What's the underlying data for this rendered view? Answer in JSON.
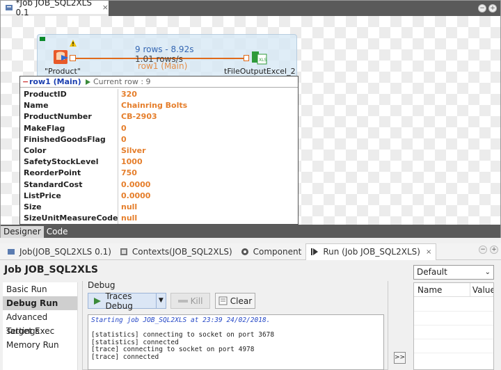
{
  "editor": {
    "tab_title": "*Job JOB_SQL2XLS 0.1",
    "tab_close": "×",
    "bottom_tabs": [
      {
        "label": "Designer",
        "active": true
      },
      {
        "label": "Code",
        "active": false
      }
    ]
  },
  "canvas": {
    "stat_rows": "9 rows - 8.92s",
    "stat_rate": "1.01 rows/s",
    "flow_label": "row1 (Main)",
    "source_component": "\"Product\"",
    "target_component": "tFileOutputExcel_2"
  },
  "trace": {
    "row_name": "row1 (Main)",
    "current_row": "Current row : 9",
    "fields": [
      {
        "key": "ProductID",
        "value": "320"
      },
      {
        "key": "Name",
        "value": "Chainring Bolts"
      },
      {
        "key": "ProductNumber",
        "value": "CB-2903"
      },
      {
        "key": "MakeFlag",
        "value": "0"
      },
      {
        "key": "FinishedGoodsFlag",
        "value": "0"
      },
      {
        "key": "Color",
        "value": "Silver"
      },
      {
        "key": "SafetyStockLevel",
        "value": "1000"
      },
      {
        "key": "ReorderPoint",
        "value": "750"
      },
      {
        "key": "StandardCost",
        "value": "0.0000"
      },
      {
        "key": "ListPrice",
        "value": "0.0000"
      },
      {
        "key": "Size",
        "value": "null"
      },
      {
        "key": "SizeUnitMeasureCode",
        "value": "null"
      }
    ]
  },
  "panel": {
    "tabs": [
      {
        "label": "Job(JOB_SQL2XLS 0.1)",
        "icon": "job-icon"
      },
      {
        "label": "Contexts(JOB_SQL2XLS)",
        "icon": "contexts-icon"
      },
      {
        "label": "Component",
        "icon": "component-icon"
      },
      {
        "label": "Run (Job JOB_SQL2XLS)",
        "icon": "run-icon",
        "close": "×"
      }
    ],
    "title": "Job JOB_SQL2XLS",
    "side_items": [
      {
        "label": "Basic Run",
        "active": false
      },
      {
        "label": "Debug Run",
        "active": true
      },
      {
        "label": "Advanced settings",
        "active": false
      },
      {
        "label": "Target Exec",
        "active": false
      },
      {
        "label": "Memory Run",
        "active": false
      }
    ],
    "debug_legend": "Debug",
    "traces_debug_label": "Traces Debug",
    "kill_label": "Kill",
    "clear_label": "Clear",
    "console_lines": [
      {
        "text": "Starting job JOB_SQL2XLS at 23:39 24/02/2018.",
        "style": "blue"
      },
      {
        "text": "",
        "style": "plain"
      },
      {
        "text": "[statistics] connecting to socket on port 3678",
        "style": "plain"
      },
      {
        "text": "[statistics] connected",
        "style": "plain"
      },
      {
        "text": "[trace] connecting to socket on port 4978",
        "style": "plain"
      },
      {
        "text": "[trace] connected",
        "style": "plain"
      }
    ],
    "expand_label": ">>",
    "context_select": "Default",
    "context_columns": [
      "Name",
      "Value"
    ]
  },
  "colors": {
    "accent_orange": "#e57e2b",
    "link_blue": "#1b3fb0"
  }
}
